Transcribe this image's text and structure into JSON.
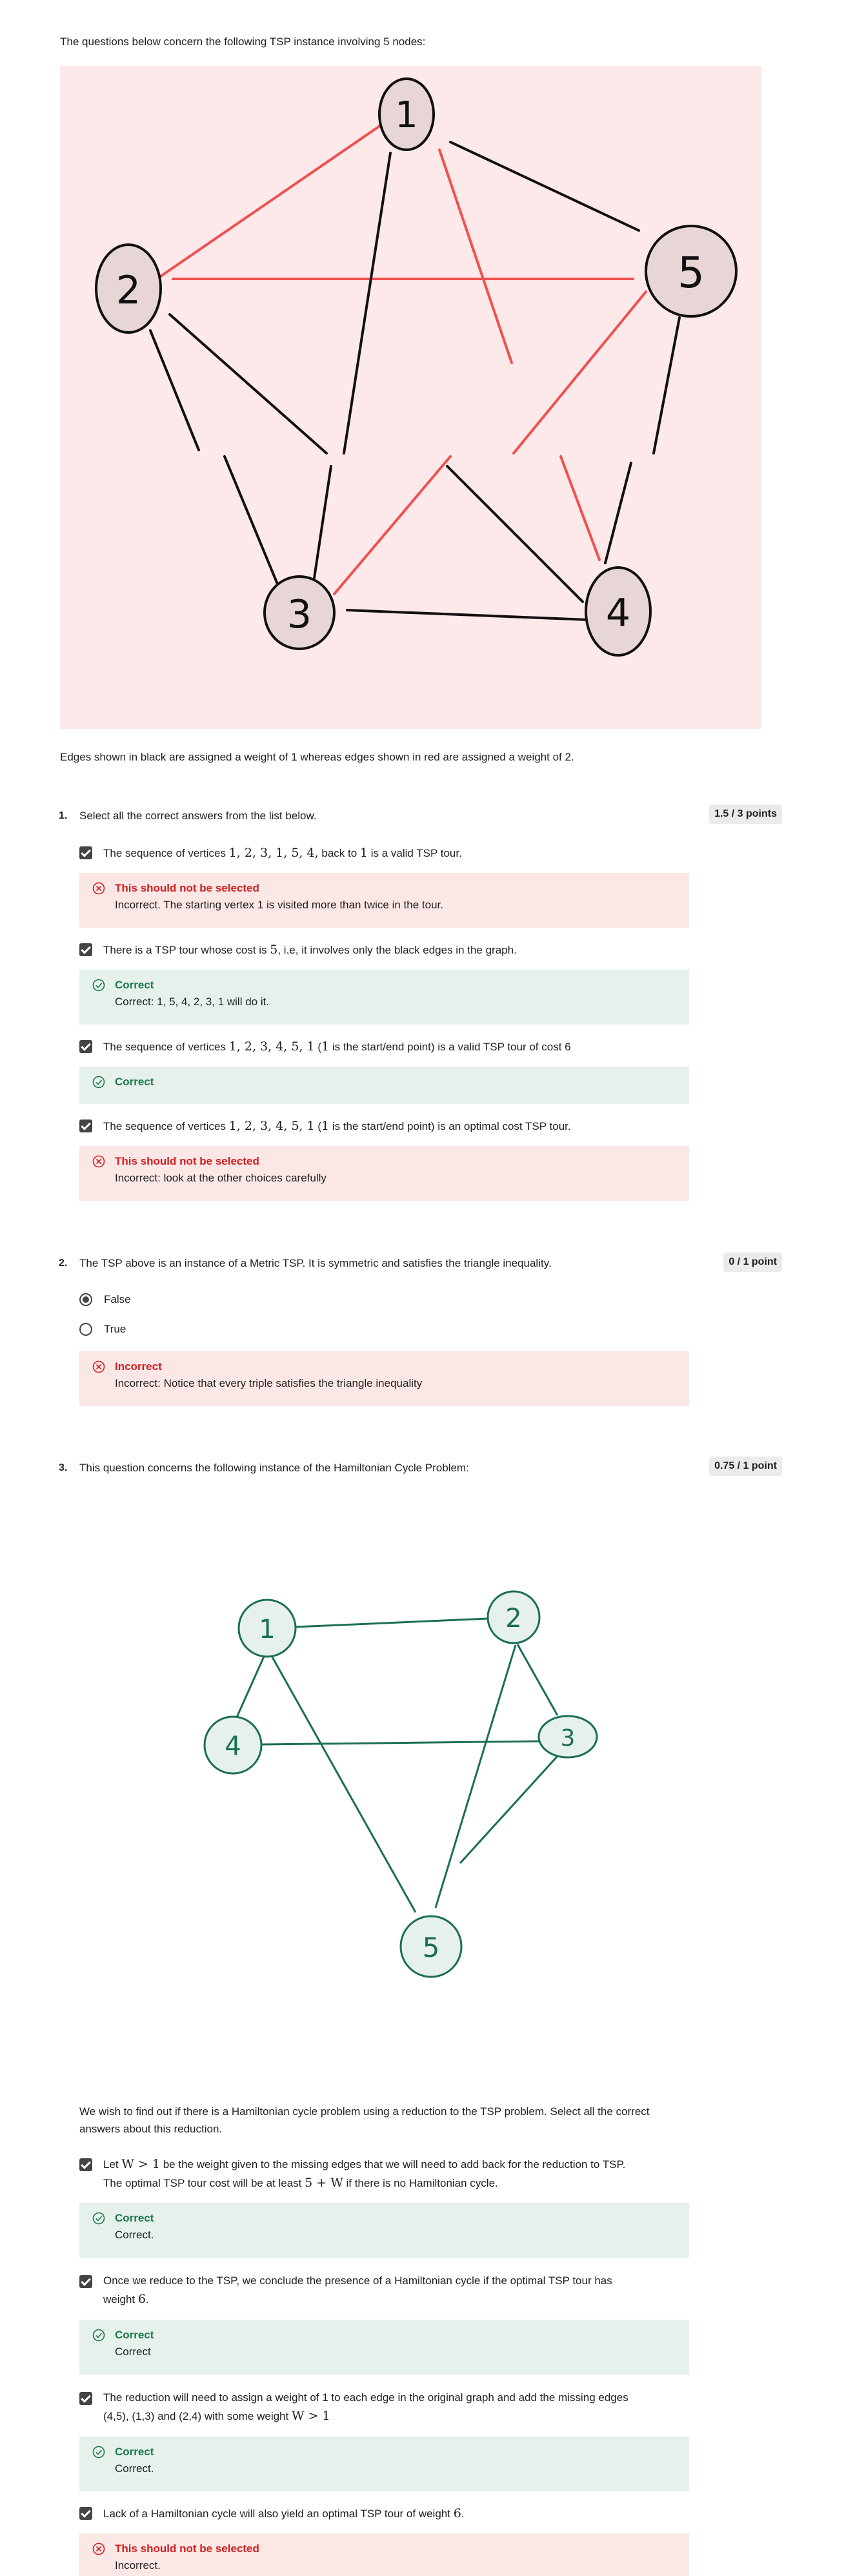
{
  "intro": "The questions below concern the following TSP instance involving 5 nodes:",
  "graph1": {
    "nodes": [
      "1",
      "2",
      "3",
      "4",
      "5"
    ],
    "colors": {
      "black_edge": "#111111",
      "red_edge": "#f05050",
      "node_fill": "#e8d6d6",
      "bg": "#fde9ea"
    }
  },
  "caption": "Edges shown in black are assigned a weight of 1 whereas edges shown in red are assigned a weight of 2.",
  "q1": {
    "number": "1.",
    "prompt": "Select all the correct answers from the list below.",
    "points": "1.5 / 3 points",
    "options": [
      {
        "pre": "The sequence of vertices ",
        "math": "1, 2, 3, 1, 5, 4,",
        "post": " back to ",
        "math2": "1",
        "post2": " is a valid TSP tour.",
        "fb_title": "This should not be selected",
        "fb_text": "Incorrect. The starting vertex 1 is visited more than twice in the tour."
      },
      {
        "pre": "There is a TSP tour whose cost is ",
        "math": "5",
        "post": ", i.e, it involves only the black edges in the graph.",
        "fb_title": "Correct",
        "fb_text": "Correct: 1, 5, 4, 2, 3, 1 will do it."
      },
      {
        "pre": "The sequence of vertices ",
        "math": "1, 2, 3, 4, 5, 1",
        "post": " (",
        "math2": "1",
        "post2": " is the start/end point) is a valid TSP tour of cost 6",
        "fb_title": "Correct"
      },
      {
        "pre": "The sequence of vertices ",
        "math": "1, 2, 3, 4, 5, 1",
        "post": " (",
        "math2": "1",
        "post2": " is the start/end point) is an optimal cost TSP tour.",
        "fb_title": "This should not be selected",
        "fb_text": "Incorrect: look at the other choices carefully"
      }
    ]
  },
  "q2": {
    "number": "2.",
    "prompt": "The TSP above is an instance of a Metric TSP. It is symmetric and satisfies the triangle inequality.",
    "points": "0 / 1 point",
    "options": [
      "False",
      "True"
    ],
    "fb_title": "Incorrect",
    "fb_text": "Incorrect: Notice that every triple satisfies the triangle inequality"
  },
  "q3": {
    "number": "3.",
    "prompt": "This question concerns the following instance of the Hamiltonian Cycle Problem:",
    "points": "0.75 / 1 point",
    "graph_nodes": [
      "1",
      "2",
      "3",
      "4",
      "5"
    ],
    "graph_color": "#1a6e55",
    "graph_fill": "#e6f1ec",
    "intro": "We wish to find out if there is a Hamiltonian cycle problem using a reduction to the TSP problem. Select all the correct answers about this reduction.",
    "options": [
      {
        "l1a": "Let ",
        "m1": "W > 1",
        "l1b": " be the weight given to the missing edges that we will need to add back for the reduction to TSP.",
        "l2a": "The optimal TSP tour cost will be at least ",
        "m2": "5 + W",
        "l2b": " if there is no Hamiltonian cycle.",
        "fb_title": "Correct",
        "fb_text": "Correct."
      },
      {
        "l1a": "Once we reduce to the TSP, we conclude the presence of a Hamiltonian cycle if the optimal TSP tour has",
        "m1": "",
        "l1b": "",
        "l2a": "weight ",
        "m2": "6",
        "l2b": ".",
        "fb_title": "Correct",
        "fb_text": "Correct"
      },
      {
        "l1a": "The reduction will need to assign a weight of 1 to each edge in the original graph and add the missing edges",
        "m1": "",
        "l1b": "",
        "l2a": "(4,5), (1,3) and (2,4) with some weight ",
        "m2": "W > 1",
        "l2b": "",
        "fb_title": "Correct",
        "fb_text": "Correct."
      },
      {
        "l1a": "Lack of a Hamiltonian cycle will also yield an optimal  TSP tour of weight ",
        "m1": "6",
        "l1b": ".",
        "fb_title": "This should not be selected",
        "fb_text": "Incorrect."
      }
    ]
  }
}
